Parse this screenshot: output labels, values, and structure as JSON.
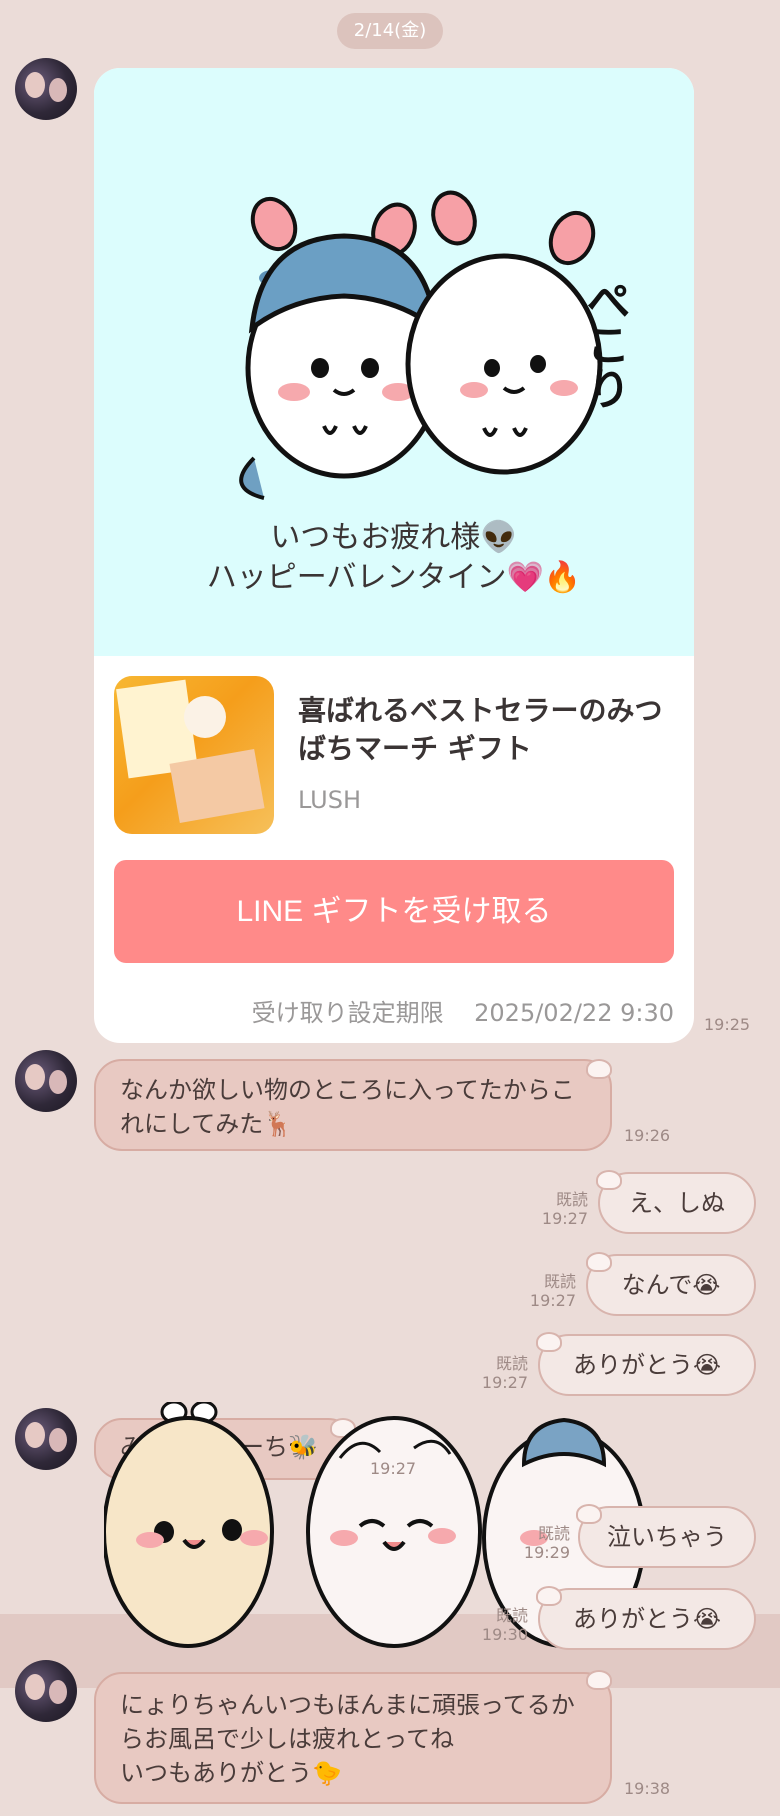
{
  "date_label": "2/14(金)",
  "gift": {
    "message_line1": "いつもお疲れ様👽",
    "message_line2": "ハッピーバレンタイン💗🔥",
    "sticker_text": "ぺこり",
    "product_title": "喜ばれるベストセラーのみつばちマーチ ギフト",
    "brand": "LUSH",
    "button_label": "LINE ギフトを受け取る",
    "deadline_label": "受け取り設定期限",
    "deadline_value": "2025/02/22 9:30",
    "time": "19:25"
  },
  "messages": [
    {
      "text": "なんか欲しい物のところに入ってたからこれにしてみた🦌",
      "time": "19:26"
    },
    {
      "text": "え、しぬ",
      "read": "既読",
      "time": "19:27"
    },
    {
      "text": "なんで😭",
      "read": "既読",
      "time": "19:27"
    },
    {
      "text": "ありがとう😭",
      "read": "既読",
      "time": "19:27"
    },
    {
      "text": "みつばちまーち🐝",
      "time": "19:27"
    },
    {
      "text": "泣いちゃう",
      "read": "既読",
      "time": "19:29"
    },
    {
      "text": "ありがとう😭",
      "read": "既読",
      "time": "19:30"
    },
    {
      "text_line1": "にょりちゃんいつもほんまに頑張ってるか",
      "text_line2": "らお風呂で少しは疲れとってね",
      "text_line3": "いつもありがとう🐤",
      "time": "19:38"
    }
  ],
  "colors": {
    "background": "#ebdcd8",
    "incoming_bubble": "#e8c9c2",
    "outgoing_bubble": "#f3e8e5",
    "gift_button": "#ff8a89",
    "gift_hero": "#dcfdfd"
  }
}
